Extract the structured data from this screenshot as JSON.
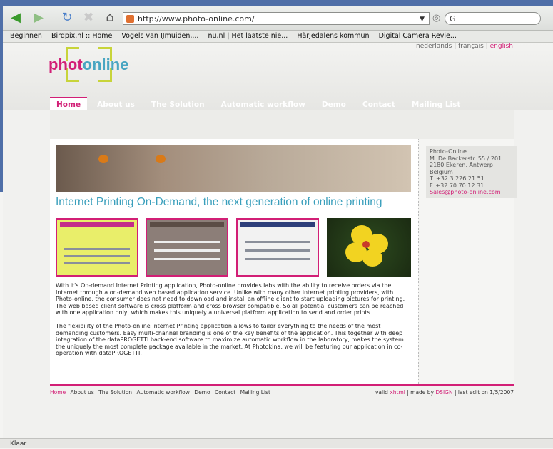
{
  "browser": {
    "url": "http://www.photo-online.com/",
    "search_placeholder": "G",
    "bookmarks": [
      "Beginnen",
      "Birdpix.nl :: Home",
      "Vogels van IJmuiden,...",
      "nu.nl | Het laatste nie...",
      "Härjedalens kommun",
      "Digital Camera Revie..."
    ],
    "status": "Klaar"
  },
  "header": {
    "languages": [
      "nederlands",
      "français",
      "english"
    ],
    "logo_part1": "phot",
    "logo_part2": "online",
    "tabs": [
      "Home",
      "About us",
      "The Solution",
      "Automatic workflow",
      "Demo",
      "Contact",
      "Mailing List"
    ]
  },
  "contact": {
    "name": "Photo-Online",
    "street": "M. De Backerstr. 55 / 201",
    "city": "2180 Ekeren, Antwerp",
    "country": "Belgium",
    "phone": "T. +32 3 226 21 51",
    "fax": "F. +32 70 70 12 31",
    "email": "Sales@photo-online.com"
  },
  "main": {
    "headline": "Internet Printing On-Demand, the next generation of online printing",
    "para1": "With it's On-demand Internet Printing application, Photo-online provides labs with the ability to receive orders via the Internet through a on-demand web based application service. Unlike with many other internet printing providers, with Photo-online, the consumer does not need to download and install an offline client to start uploading pictures for printing. The web based client software is cross platform and cross browser compatible. So all potential customers can be reached with one application only, which makes this uniquely a universal platform application to send and order prints.",
    "para2": "The flexibility of the Photo-online Internet Printing application allows to tailor everything to the needs of the most demanding customers. Easy multi-channel branding is one of the key benefits of the application. This together with deep integration of the dataPROGETTI back-end software to maximize automatic workflow in the laboratory, makes the system the uniquely the most complete package available in the market. At Photokina, we will be featuring our application in co-operation with dataPROGETTI."
  },
  "footer": {
    "links": [
      "Home",
      "About us",
      "The Solution",
      "Automatic workflow",
      "Demo",
      "Contact",
      "Mailing List"
    ],
    "valid": "valid",
    "xhtml": "xhtml",
    "made_by": "| made by",
    "designer": "DSIGN",
    "last_edit": "| last edit on 1/5/2007"
  }
}
